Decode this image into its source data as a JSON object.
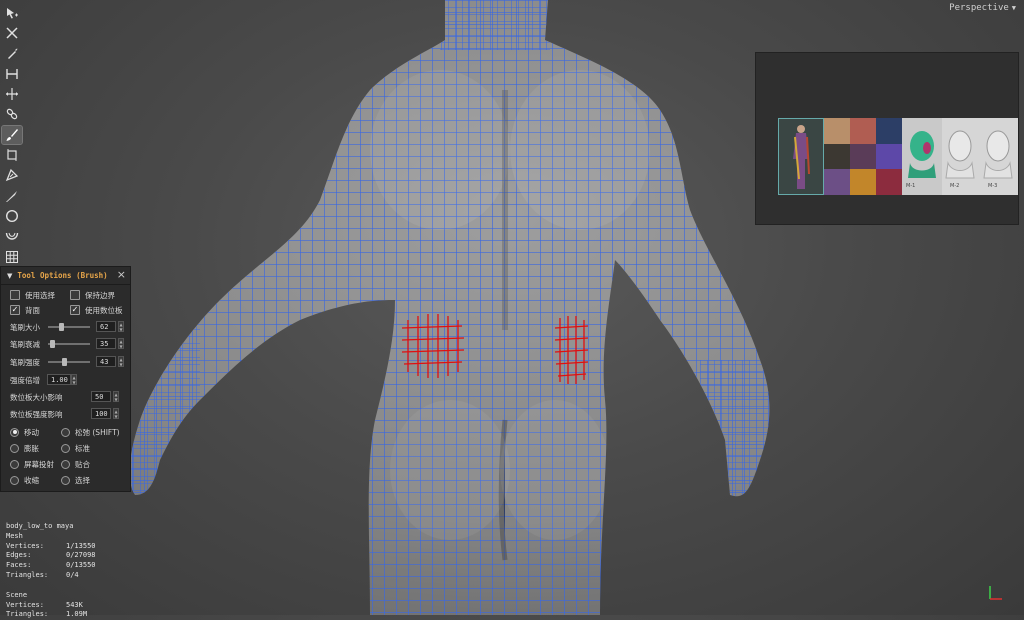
{
  "viewport": {
    "camera_label": "Perspective"
  },
  "toolbar": {
    "tools": [
      {
        "icon": "select-arrow-icon"
      },
      {
        "icon": "transform-cross-icon"
      },
      {
        "icon": "pen-icon"
      },
      {
        "icon": "measure-icon"
      },
      {
        "icon": "move-axes-icon"
      },
      {
        "icon": "link-chain-icon"
      },
      {
        "icon": "brush-icon",
        "active": true
      },
      {
        "icon": "bounding-box-icon"
      },
      {
        "icon": "fill-bucket-icon"
      },
      {
        "icon": "knife-icon"
      },
      {
        "icon": "circle-icon"
      },
      {
        "icon": "arc-icon"
      },
      {
        "icon": "grid-icon"
      }
    ]
  },
  "tool_options": {
    "title": "Tool Options (Brush)",
    "use_selection": "使用选择",
    "keep_border": "保持边界",
    "backface": "背面",
    "use_tablet": "使用数位板",
    "brush_size": {
      "label": "笔刷大小",
      "value": "62",
      "fraction": 0.3
    },
    "brush_falloff": {
      "label": "笔刷衰减",
      "value": "35",
      "fraction": 0.1
    },
    "brush_strength": {
      "label": "笔刷强度",
      "value": "43",
      "fraction": 0.38
    },
    "strength_multiplier": {
      "label": "强度倍增",
      "value": "1.00"
    },
    "tablet_size_influence": {
      "label": "数位板大小影响",
      "value": "50"
    },
    "tablet_strength_influence": {
      "label": "数位板强度影响",
      "value": "100"
    },
    "modes": [
      {
        "label": "移动",
        "selected": true
      },
      {
        "label": "松弛 (SHIFT)",
        "selected": false
      },
      {
        "label": "膨胀",
        "selected": false
      },
      {
        "label": "标准",
        "selected": false
      },
      {
        "label": "屏幕投射",
        "selected": false
      },
      {
        "label": "贴合",
        "selected": false
      },
      {
        "label": "收缩",
        "selected": false
      },
      {
        "label": "选择",
        "selected": false
      }
    ]
  },
  "thumbnails": {
    "labels": [
      "M-1",
      "M-2",
      "M-3"
    ]
  },
  "stats": {
    "object_name": "body_low_to maya",
    "type": "Mesh",
    "vertices": {
      "label": "Vertices:",
      "value": "1/13550"
    },
    "edges": {
      "label": "Edges:",
      "value": "0/27098"
    },
    "faces": {
      "label": "Faces:",
      "value": "0/13550"
    },
    "triangles": {
      "label": "Triangles:",
      "value": "0/4"
    },
    "scene_label": "Scene",
    "scene_vertices": {
      "label": "Vertices:",
      "value": "543K"
    },
    "scene_triangles": {
      "label": "Triangles:",
      "value": "1.09M"
    }
  },
  "colors": {
    "mesh_fill": "#8c8c8c",
    "wire": "#2f5fe0",
    "selected_wire": "#e01010",
    "panel_title": "#e8a64a"
  }
}
